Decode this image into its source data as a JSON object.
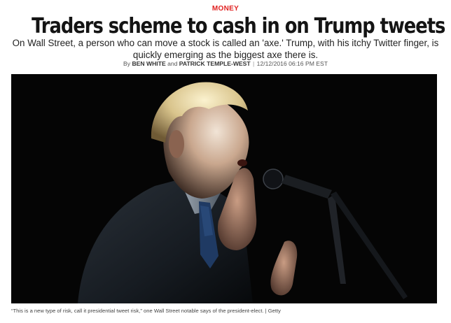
{
  "article": {
    "section": "MONEY",
    "headline": "Traders scheme to cash in on Trump tweets",
    "dek": "On Wall Street, a person who can move a stock is called an 'axe.' Trump, with his itchy Twitter finger, is quickly emerging as the biggest axe there is.",
    "byline": {
      "prefix": "By",
      "author_1": "BEN WHITE",
      "conjunction": "and",
      "author_2": "PATRICK TEMPLE-WEST",
      "separator": "|",
      "timestamp": "12/12/2016 06:16 PM EST"
    },
    "photo": {
      "caption": "“This is a new type of risk, call it presidential tweet risk,” one Wall Street notable says of the president-elect. | Getty"
    }
  },
  "colors": {
    "section_accent": "#e0201f",
    "headline": "#141414",
    "photo_background": "#050505"
  }
}
